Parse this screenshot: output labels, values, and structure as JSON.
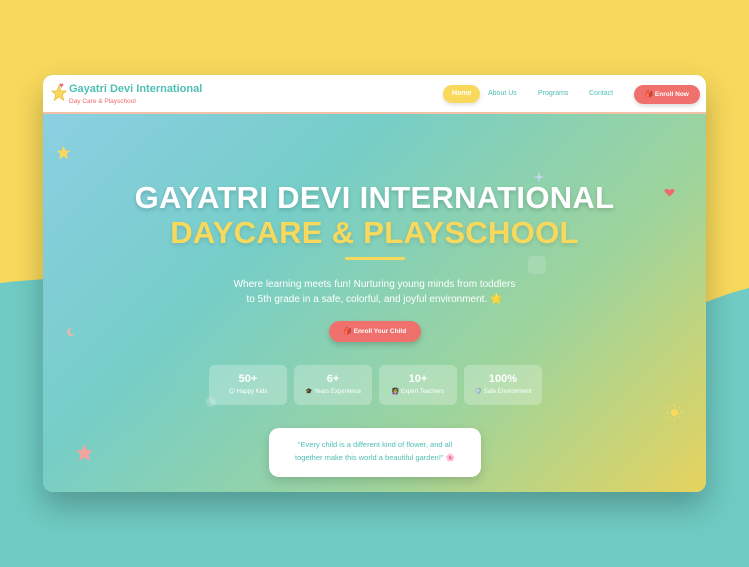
{
  "nav": {
    "brand_title": "Gayatri Devi International",
    "brand_subtitle": "Day Care & Playschool",
    "links": [
      "Home",
      "About Us",
      "Programs",
      "Contact"
    ],
    "active_link": "Home",
    "enroll_label": "🎒 Enroll Now"
  },
  "hero": {
    "title_line1": "GAYATRI DEVI INTERNATIONAL",
    "title_line2": "DAYCARE & PLAYSCHOOL",
    "description_line1": "Where learning meets fun! Nurturing young minds from toddlers",
    "description_line2": "to 5th grade in a safe, colorful, and joyful environment. 🌟",
    "cta_label": "🎒 Enroll Your Child"
  },
  "stats": [
    {
      "value": "50+",
      "label": "😊 Happy Kids"
    },
    {
      "value": "6+",
      "label": "🎓 Years Experience"
    },
    {
      "value": "10+",
      "label": "👩‍🏫 Expert Teachers"
    },
    {
      "value": "100%",
      "label": "🛡️ Safe Environment"
    }
  ],
  "quote": {
    "line1": "\"Every child is a different kind of flower, and all",
    "line2": "together make this world a beautiful garden!\" 🌸"
  },
  "colors": {
    "brand_teal": "#4fbfb4",
    "accent_yellow": "#f8d95c",
    "accent_coral": "#ef706c",
    "page_background_teal": "#6fcbc3"
  },
  "icons": [
    "star-icon",
    "heart-icon",
    "sparkle-icon",
    "sun-icon",
    "moon-icon"
  ]
}
